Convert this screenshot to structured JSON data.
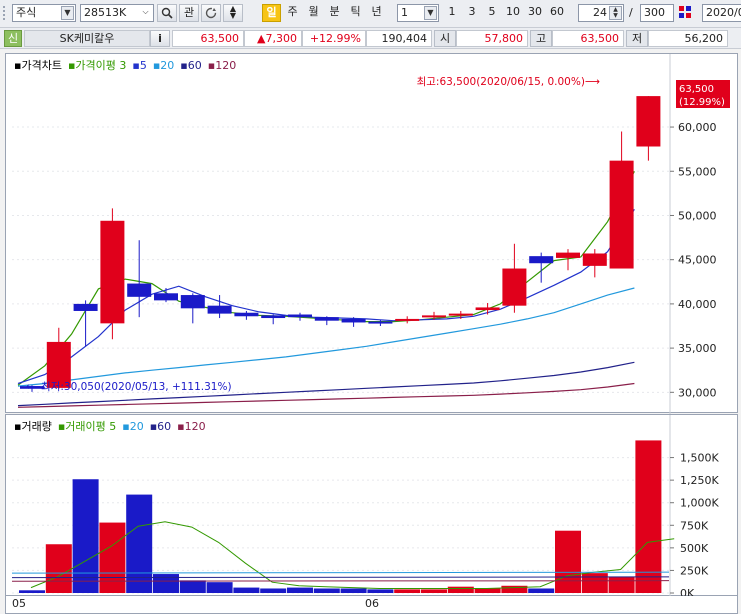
{
  "toolbar": {
    "market": "주식",
    "code": "28513K",
    "btn_link": "관",
    "periods": [
      "일",
      "주",
      "월",
      "분",
      "틱",
      "년"
    ],
    "active_period": "일",
    "minute_select": "1",
    "presets": [
      "1",
      "3",
      "5",
      "10",
      "30",
      "60"
    ],
    "count": "24",
    "slash": "/",
    "total": "300",
    "date": "2020/0"
  },
  "info": {
    "badge": "신",
    "name": "SK케미칼우",
    "info_btn": "i",
    "price": "63,500",
    "change": "▲7,300",
    "rate": "+12.99%",
    "volume": "190,404",
    "open_label": "시",
    "open": "57,800",
    "high_label": "고",
    "high": "63,500",
    "low_label": "저",
    "low": "56,200"
  },
  "price_panel": {
    "legend": [
      {
        "text": "가격차트",
        "color": "#000000"
      },
      {
        "text": "가격이평 3",
        "color": "#339900"
      },
      {
        "text": "5",
        "color": "#2233cc"
      },
      {
        "text": "20",
        "color": "#2299dd"
      },
      {
        "text": "60",
        "color": "#22228a"
      },
      {
        "text": "120",
        "color": "#8a1f4a"
      }
    ],
    "y_ticks": [
      "60,000",
      "55,000",
      "50,000",
      "45,000",
      "40,000",
      "35,000",
      "30,000"
    ],
    "high_annotation": "최고:63,500(2020/06/15, 0.00%)⟶",
    "low_annotation": "⟵최저:30,050(2020/05/13, +111.31%)",
    "current_price": "63,500",
    "current_rate": "(12.99%)"
  },
  "volume_panel": {
    "legend": [
      {
        "text": "거래량",
        "color": "#000000"
      },
      {
        "text": "거래이평 5",
        "color": "#339900"
      },
      {
        "text": "20",
        "color": "#2299dd"
      },
      {
        "text": "60",
        "color": "#22228a"
      },
      {
        "text": "120",
        "color": "#8a1f4a"
      }
    ],
    "y_ticks": [
      "1,500K",
      "1,250K",
      "1,000K",
      "750K",
      "500K",
      "250K",
      "0K"
    ]
  },
  "x_ticks": [
    "05",
    "06"
  ],
  "colors": {
    "up": "#e0001b",
    "down": "#1a1ac8",
    "ma3": "#339900",
    "ma5": "#2233cc",
    "ma20": "#2299dd",
    "ma60": "#22228a",
    "ma120": "#8a1f4a"
  },
  "chart_data": {
    "type": "candlestick",
    "x": [
      "05/13",
      "05/14",
      "05/15",
      "05/18",
      "05/19",
      "05/20",
      "05/21",
      "05/22",
      "05/25",
      "05/26",
      "05/27",
      "05/28",
      "05/29",
      "06/01",
      "06/02",
      "06/03",
      "06/04",
      "06/05",
      "06/08",
      "06/09",
      "06/10",
      "06/11",
      "06/12",
      "06/15"
    ],
    "open": [
      30700,
      30500,
      40000,
      37800,
      42300,
      41200,
      41000,
      39800,
      39000,
      38700,
      38800,
      38500,
      38300,
      38000,
      38100,
      38500,
      38700,
      39300,
      39800,
      45400,
      45200,
      44300,
      44000,
      57800
    ],
    "close": [
      30400,
      35700,
      39200,
      49400,
      40800,
      40400,
      39500,
      38900,
      38600,
      38400,
      38500,
      38100,
      37900,
      37900,
      38300,
      38700,
      38900,
      39600,
      44000,
      44600,
      45800,
      45700,
      56200,
      63500
    ],
    "high": [
      30800,
      37300,
      40400,
      50800,
      47200,
      41800,
      41200,
      41000,
      39200,
      38800,
      39000,
      38600,
      38500,
      38200,
      38600,
      39100,
      39200,
      40100,
      46800,
      45800,
      46200,
      46200,
      59500,
      63500
    ],
    "low": [
      30050,
      30400,
      35200,
      36000,
      38500,
      40200,
      37800,
      38400,
      38200,
      37700,
      38100,
      37600,
      37400,
      37500,
      37800,
      38200,
      38300,
      38800,
      39000,
      42400,
      43800,
      43000,
      44000,
      56200
    ],
    "volume": [
      30000,
      540000,
      1260000,
      780000,
      1090000,
      210000,
      140000,
      120000,
      60000,
      50000,
      60000,
      50000,
      50000,
      40000,
      40000,
      40000,
      70000,
      50000,
      80000,
      50000,
      690000,
      220000,
      180000,
      1690000,
      190000
    ],
    "ma": {
      "3": [
        30800,
        33000,
        36600,
        41700,
        42800,
        42300,
        40300,
        39600,
        39000,
        38700,
        38600,
        38400,
        38200,
        38000,
        38000,
        38200,
        38500,
        38800,
        40000,
        42500,
        44900,
        45300,
        49300,
        55000
      ],
      "5": [
        31000,
        32000,
        34000,
        36300,
        39300,
        41100,
        42000,
        40800,
        39800,
        39100,
        38700,
        38500,
        38400,
        38300,
        38100,
        38200,
        38300,
        38600,
        39400,
        40700,
        42100,
        43600,
        45900,
        50700
      ],
      "20": [
        30700,
        31000,
        31400,
        31800,
        32200,
        32500,
        32800,
        33100,
        33400,
        33700,
        34000,
        34400,
        34800,
        35200,
        35700,
        36200,
        36700,
        37200,
        37700,
        38300,
        39000,
        40000,
        41000,
        41800
      ],
      "60": [
        28500,
        28650,
        28800,
        28950,
        29100,
        29250,
        29400,
        29550,
        29700,
        29850,
        30000,
        30150,
        30300,
        30450,
        30600,
        30750,
        30900,
        31050,
        31300,
        31600,
        31900,
        32300,
        32800,
        33400
      ],
      "120": [
        28300,
        28380,
        28460,
        28540,
        28620,
        28700,
        28780,
        28860,
        28940,
        29020,
        29100,
        29180,
        29260,
        29340,
        29420,
        29500,
        29580,
        29660,
        29800,
        29950,
        30100,
        30300,
        30600,
        31000
      ]
    },
    "volume_ma5": [
      60000,
      180000,
      350000,
      520000,
      740000,
      790000,
      730000,
      560000,
      330000,
      120000,
      80000,
      70000,
      60000,
      50000,
      50000,
      50000,
      50000,
      50000,
      60000,
      70000,
      190000,
      230000,
      260000,
      560000,
      600000
    ],
    "ylim_price": [
      28000,
      66000
    ],
    "ylim_volume": [
      0,
      1750000
    ]
  }
}
